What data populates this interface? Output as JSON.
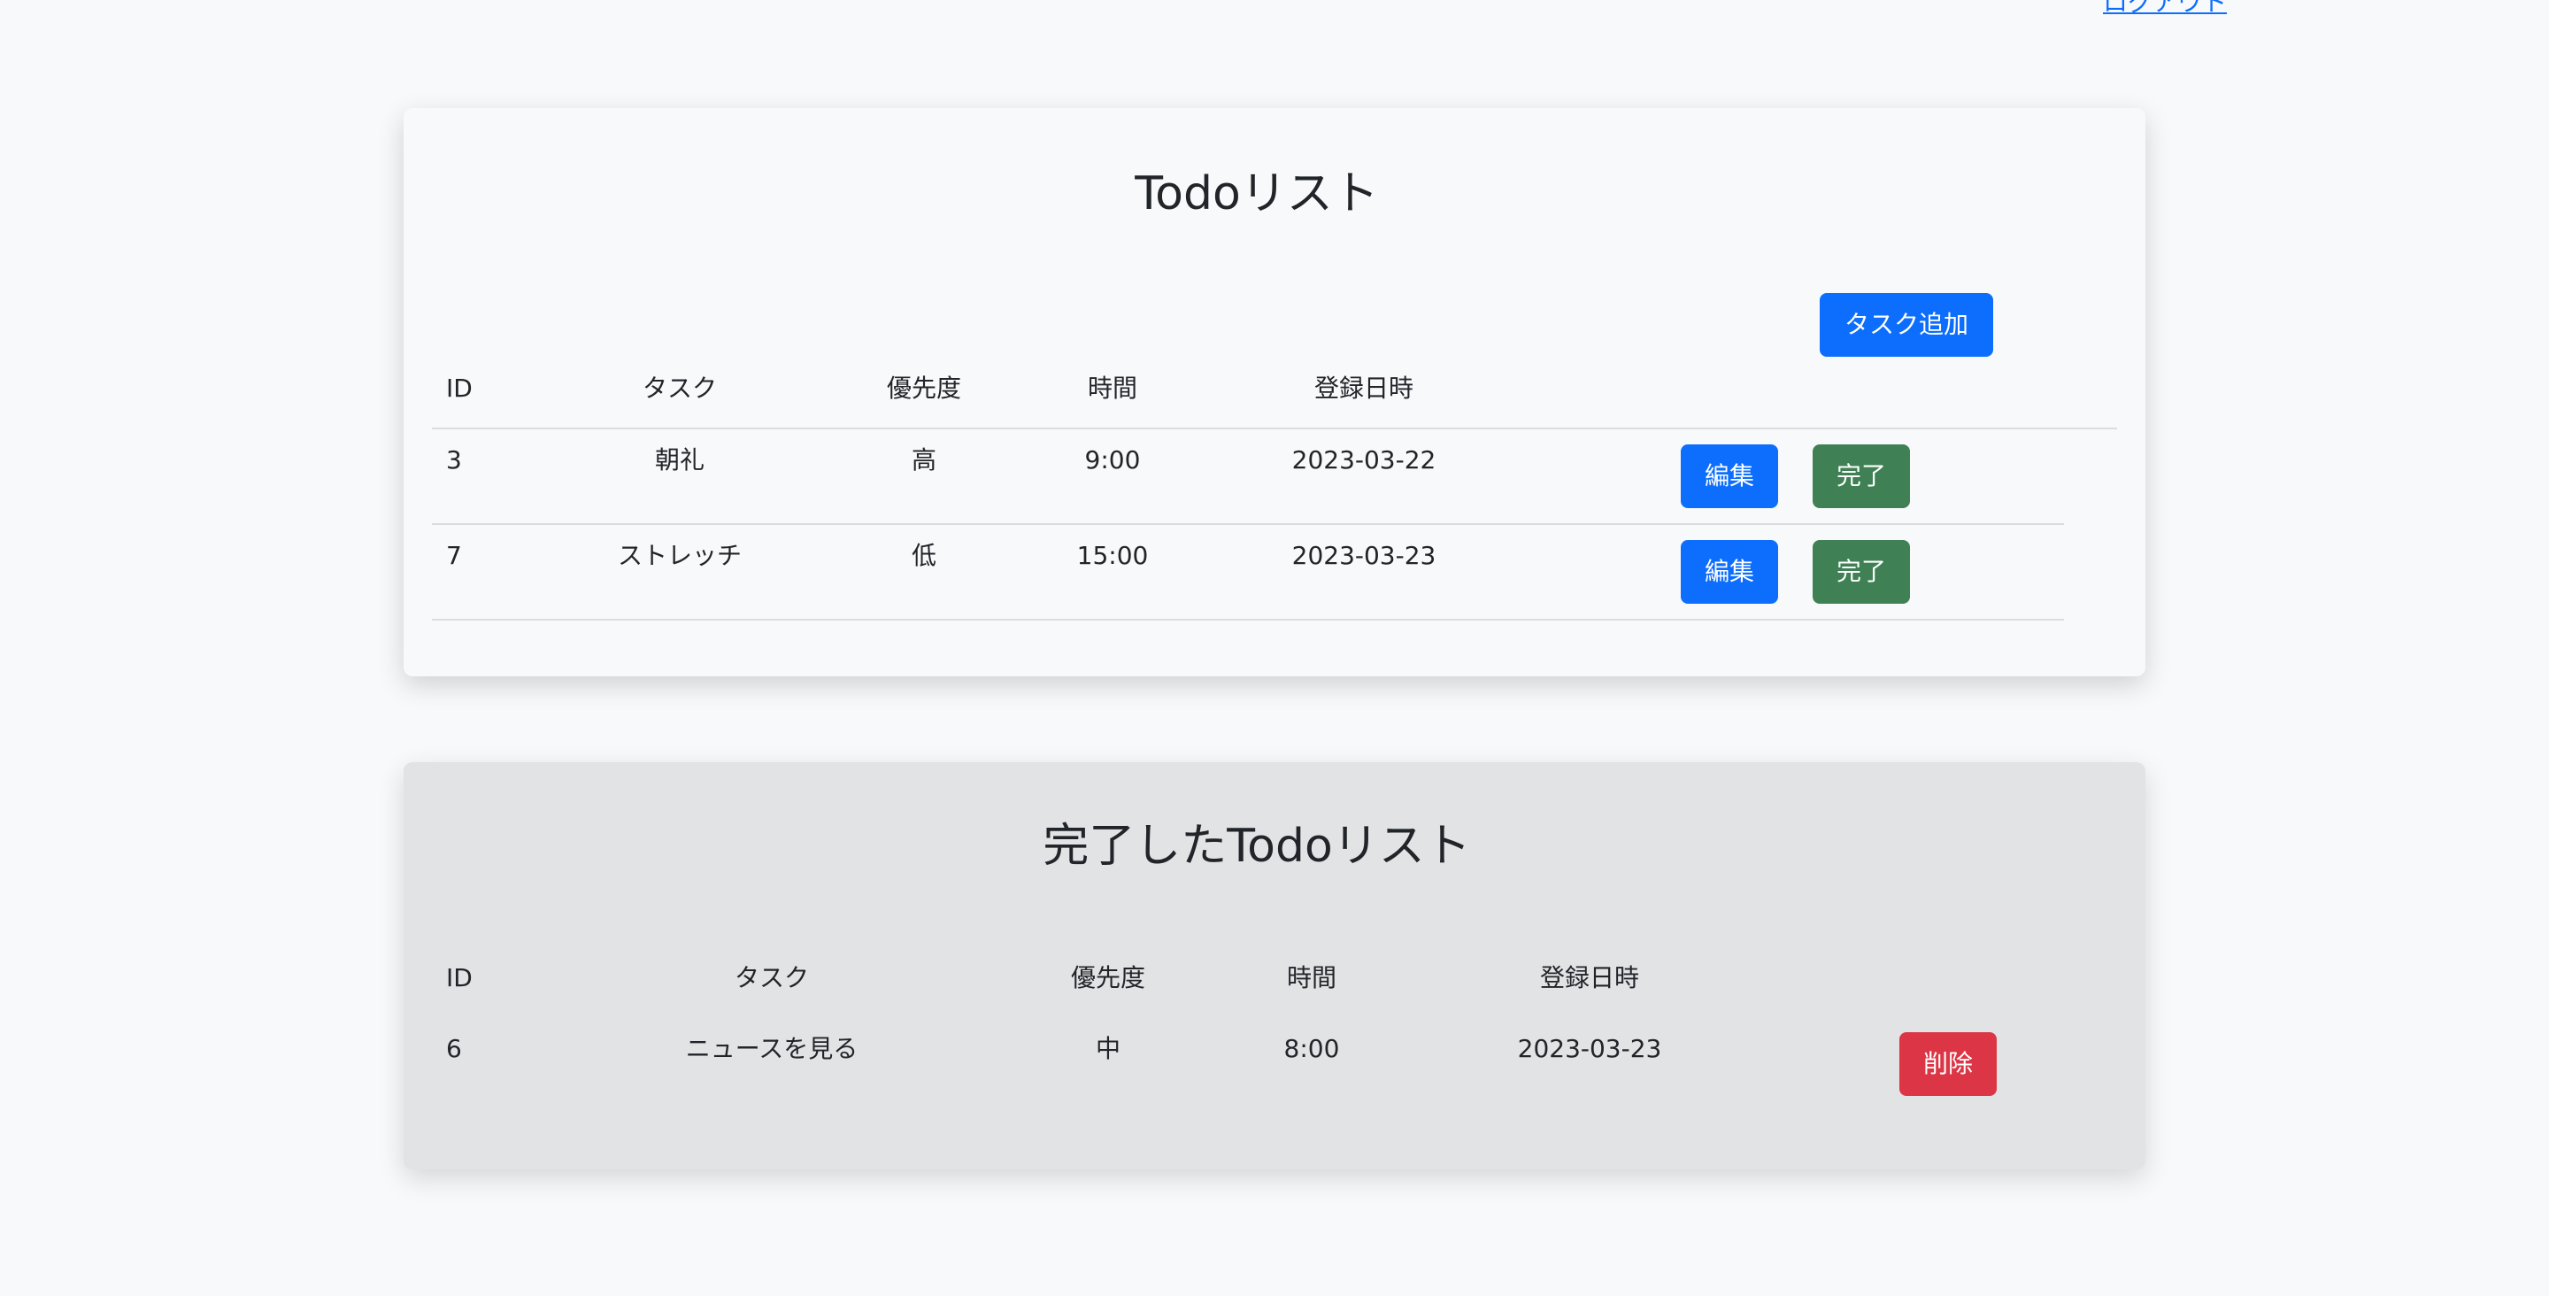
{
  "header": {
    "logout_label": "ログアウト"
  },
  "todo": {
    "title": "Todoリスト",
    "add_button": "タスク追加",
    "headers": {
      "id": "ID",
      "task": "タスク",
      "priority": "優先度",
      "time": "時間",
      "registered": "登録日時"
    },
    "rows": [
      {
        "id": "3",
        "task": "朝礼",
        "priority": "高",
        "time": "9:00",
        "date": "2023-03-22",
        "edit_label": "編集",
        "complete_label": "完了"
      },
      {
        "id": "7",
        "task": "ストレッチ",
        "priority": "低",
        "time": "15:00",
        "date": "2023-03-23",
        "edit_label": "編集",
        "complete_label": "完了"
      }
    ]
  },
  "done": {
    "title": "完了したTodoリスト",
    "headers": {
      "id": "ID",
      "task": "タスク",
      "priority": "優先度",
      "time": "時間",
      "registered": "登録日時"
    },
    "rows": [
      {
        "id": "6",
        "task": "ニュースを見る",
        "priority": "中",
        "time": "8:00",
        "date": "2023-03-23",
        "delete_label": "削除"
      }
    ]
  },
  "colors": {
    "primary": "#0d6efd",
    "success": "#3f8155",
    "danger": "#dc3545",
    "page_bg": "#f8f9fa",
    "done_card_bg": "#e2e3e5"
  }
}
